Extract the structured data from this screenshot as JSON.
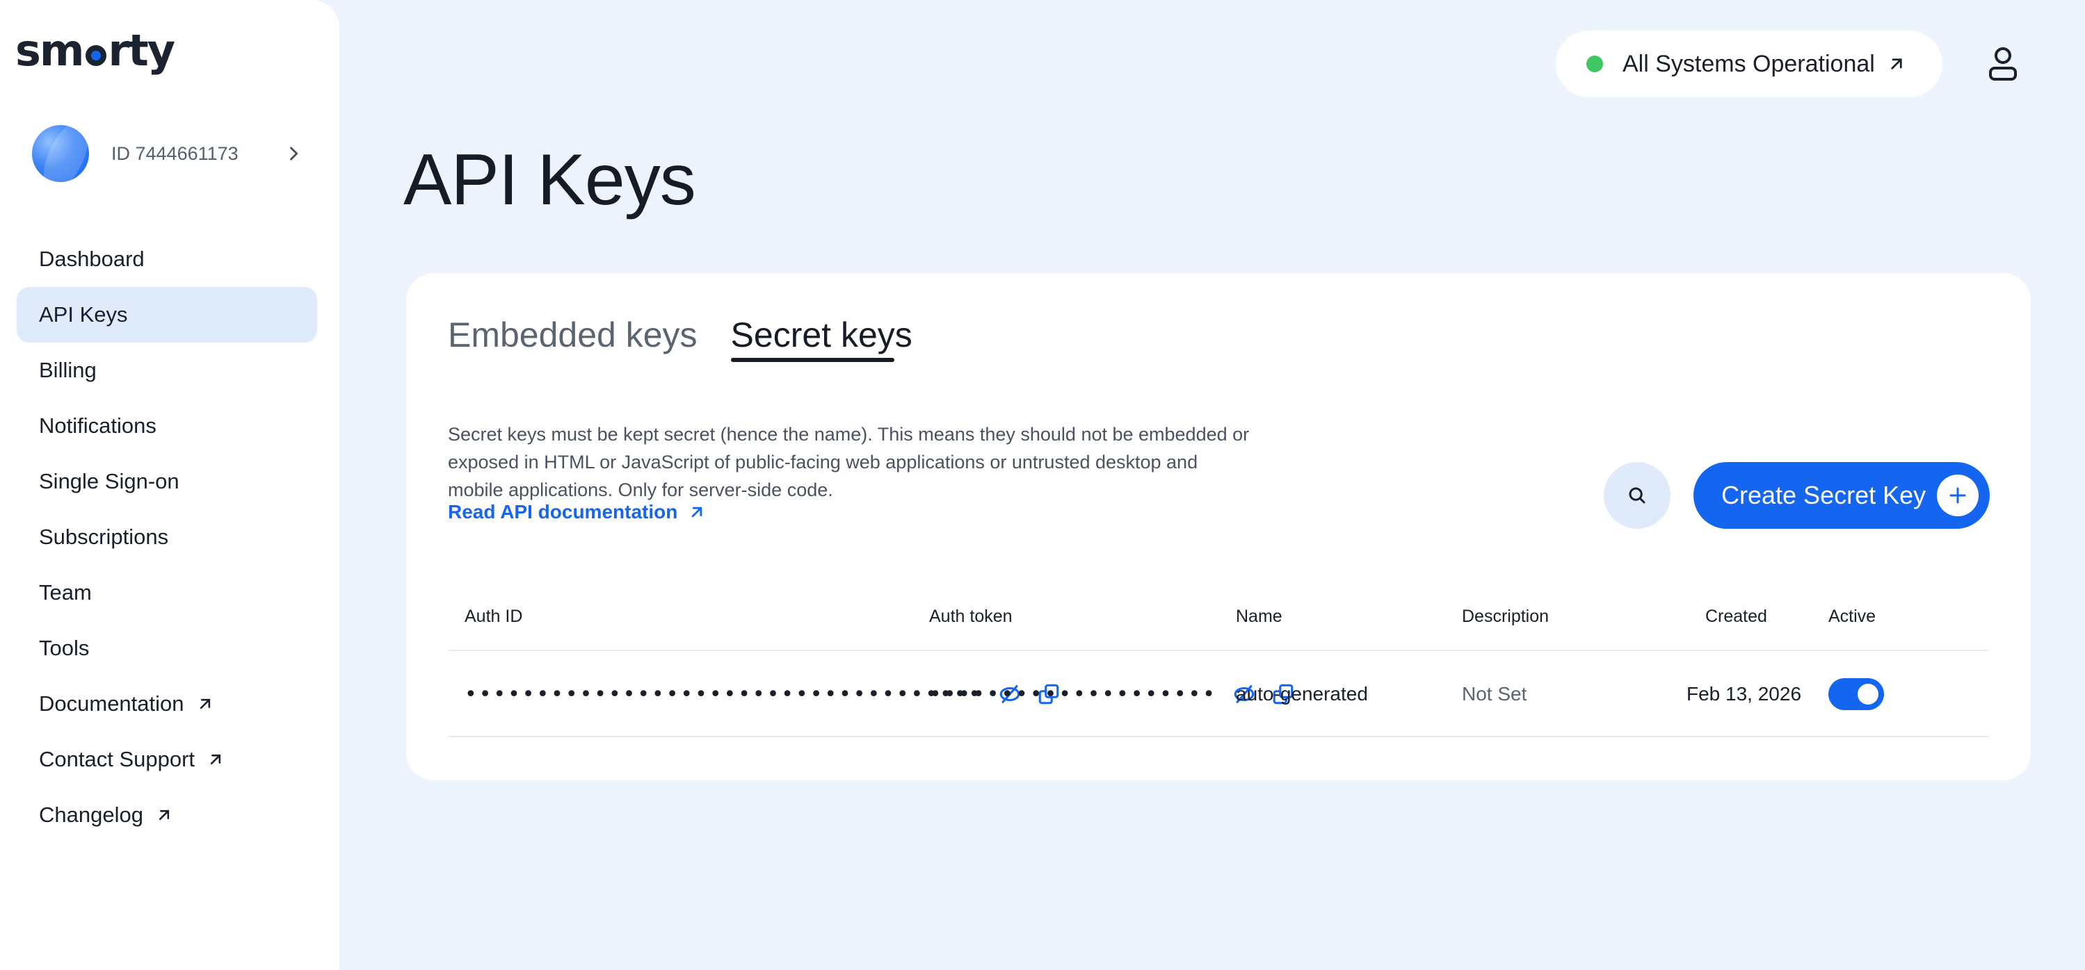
{
  "app": {
    "logo_prefix": "sm",
    "logo_suffix": "rty"
  },
  "account": {
    "id_label": "ID 7444661173"
  },
  "sidebar": {
    "items": [
      {
        "label": "Dashboard",
        "external": false,
        "active": false
      },
      {
        "label": "API Keys",
        "external": false,
        "active": true
      },
      {
        "label": "Billing",
        "external": false,
        "active": false
      },
      {
        "label": "Notifications",
        "external": false,
        "active": false
      },
      {
        "label": "Single Sign-on",
        "external": false,
        "active": false
      },
      {
        "label": "Subscriptions",
        "external": false,
        "active": false
      },
      {
        "label": "Team",
        "external": false,
        "active": false
      },
      {
        "label": "Tools",
        "external": false,
        "active": false
      },
      {
        "label": "Documentation",
        "external": true,
        "active": false
      },
      {
        "label": "Contact Support",
        "external": true,
        "active": false
      },
      {
        "label": "Changelog",
        "external": true,
        "active": false
      }
    ]
  },
  "header": {
    "status_text": "All Systems Operational",
    "status_color": "#3fc764"
  },
  "page": {
    "title": "API Keys"
  },
  "tabs": [
    {
      "label": "Embedded keys",
      "active": false
    },
    {
      "label": "Secret keys",
      "active": true
    }
  ],
  "description": "Secret keys must be kept secret (hence the name). This means they should not be embedded or exposed in HTML or JavaScript of public-facing web applications or untrusted desktop and mobile applications. Only for server-side code.",
  "doc_link": "Read API documentation",
  "actions": {
    "create_label": "Create Secret Key"
  },
  "table": {
    "headers": {
      "auth_id": "Auth ID",
      "auth_token": "Auth token",
      "name": "Name",
      "description": "Description",
      "created": "Created",
      "active": "Active"
    },
    "rows": [
      {
        "auth_id": "••••••••••••••••••••••••••••••••••••",
        "auth_token": "••••••••••••••••••••",
        "name": "auto-generated",
        "description": "Not Set",
        "created": "Feb 13, 2026",
        "active": true
      }
    ]
  },
  "colors": {
    "accent": "#1466f0",
    "background": "#edf4fd",
    "active_nav": "#dfeafb"
  },
  "icons": [
    "chevron-right-icon",
    "external-link-icon",
    "user-icon",
    "search-icon",
    "plus-icon",
    "eye-off-icon",
    "copy-icon"
  ]
}
